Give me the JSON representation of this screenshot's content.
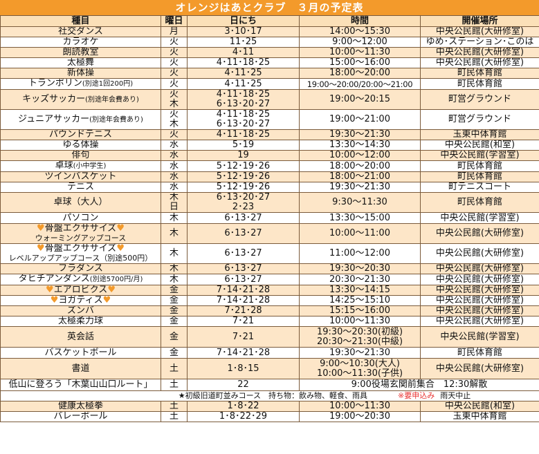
{
  "title": "オレンジはあとクラブ　３月の予定表",
  "columns": [
    "種目",
    "曜日",
    "日にち",
    "時間",
    "開催場所"
  ],
  "rows": [
    {
      "name": "社交ダンス",
      "day": "月",
      "dates": "3･10･17",
      "time": "14:00～15:30",
      "place": "中央公民館(大研修室)"
    },
    {
      "name": "カラオケ",
      "day": "火",
      "dates": "11･25",
      "time": "9:00～12:00",
      "place": "ゆめ･ステーション･このは"
    },
    {
      "name": "朗読教室",
      "day": "火",
      "dates": "4･11",
      "time": "10:00～11:30",
      "place": "中央公民館(大研修室)"
    },
    {
      "name": "太極舞",
      "day": "火",
      "dates": "4･11･18･25",
      "time": "15:00～16:00",
      "place": "中央公民館(大研修室)"
    },
    {
      "name": "新体操",
      "day": "火",
      "dates": "4･11･25",
      "time": "18:00～20:00",
      "place": "町民体育館"
    },
    {
      "name": "トランポリン",
      "name_note": "(別途1回200円)",
      "day": "火",
      "dates": "4･11･25",
      "time": "19:00～20:00/20:00～21:00",
      "place": "町民体育館"
    },
    {
      "name": "キッズサッカー",
      "name_note": "(別途年会費あり)",
      "day": "火",
      "day2": "木",
      "dates": "4･11･18･25",
      "dates2": "6･13･20･27",
      "time": "19:00～20:15",
      "place": "町営グラウンド"
    },
    {
      "name": "ジュニアサッカー",
      "name_note": "(別途年会費あり)",
      "day": "火",
      "day2": "木",
      "dates": "4･11･18･25",
      "dates2": "6･13･20･27",
      "time": "19:00～21:00",
      "place": "町営グラウンド"
    },
    {
      "name": "パウンドテニス",
      "day": "火",
      "dates": "4･11･18･25",
      "time": "19:30～21:30",
      "place": "玉東中体育館"
    },
    {
      "name": "ゆる体操",
      "day": "水",
      "dates": "5･19",
      "time": "13:30～14:30",
      "place": "中央公民館(和室)"
    },
    {
      "name": "俳句",
      "day": "水",
      "dates": "19",
      "time": "10:00～12:00",
      "place": "中央公民館(学習室)"
    },
    {
      "name": "卓球",
      "name_note": "(小中学生)",
      "day": "水",
      "dates": "5･12･19･26",
      "time": "18:00～20:00",
      "place": "町民体育館"
    },
    {
      "name": "ツインバスケット",
      "day": "水",
      "dates": "5･12･19･26",
      "time": "18:00～21:00",
      "place": "町民体育館"
    },
    {
      "name": "テニス",
      "day": "水",
      "dates": "5･12･19･26",
      "time": "19:30～21:30",
      "place": "町テニスコート"
    },
    {
      "name": "卓球（大人）",
      "day": "木",
      "day2": "日",
      "dates": "6･13･20･27",
      "dates2": "2･23",
      "time": "9:30～11:30",
      "place": "町民体育館"
    },
    {
      "name": "パソコン",
      "day": "木",
      "dates": "6･13･27",
      "time": "13:30～15:00",
      "place": "中央公民館(学習室)"
    },
    {
      "name": "骨盤エクササイズ",
      "name_sub": "ウォーミングアップコース",
      "heart": "♥",
      "day": "木",
      "dates": "6･13･27",
      "time": "10:00～11:00",
      "place": "中央公民館(大研修室)"
    },
    {
      "name": "骨盤エクササイズ",
      "name_sub": "レベルアップアップコース（別途500円）",
      "heart": "♥",
      "day": "木",
      "dates": "6･13･27",
      "time": "11:00～12:00",
      "place": "中央公民館(大研修室)"
    },
    {
      "name": "フラダンス",
      "day": "木",
      "dates": "6･13･27",
      "time": "19:30～20:30",
      "place": "中央公民館(大研修室)"
    },
    {
      "name": "タヒチアンダンス",
      "name_note": "(別途5700円/月)",
      "day": "木",
      "dates": "6･13･27",
      "time": "20:30～21:30",
      "place": "中央公民館(大研修室)"
    },
    {
      "name": "エアロビクス",
      "heart": "♥",
      "day": "金",
      "dates": "7･14･21･28",
      "time": "13:30～14:15",
      "place": "中央公民館(大研修室)"
    },
    {
      "name": "ヨガティス",
      "heart": "♥",
      "day": "金",
      "dates": "7･14･21･28",
      "time": "14:25～15:10",
      "place": "中央公民館(大研修室)"
    },
    {
      "name": "ズンバ",
      "day": "金",
      "dates": "7･21･28",
      "time": "15:15～16:00",
      "place": "中央公民館(大研修室)"
    },
    {
      "name": "太極柔力球",
      "day": "金",
      "dates": "7･21",
      "time": "10:00～11:30",
      "place": "中央公民館(大研修室)"
    },
    {
      "name": "英会話",
      "day": "金",
      "dates": "7･21",
      "time": "19:30～20:30(初級)",
      "time2": "20:30～21:30(中級)",
      "place": "中央公民館(学習室)"
    },
    {
      "name": "バスケットボール",
      "day": "金",
      "dates": "7･14･21･28",
      "time": "19:30～21:30",
      "place": "町民体育館"
    },
    {
      "name": "書道",
      "day": "土",
      "dates": "1･8･15",
      "time": "9:00～10:30(大人)",
      "time2": "10:00～11:30(子供)",
      "place": "中央公民館(大研修室)"
    },
    {
      "name": "低山に登ろう「木葉山山口ルート」",
      "day": "土",
      "dates": "22",
      "time": "9:00役場玄関前集合　12:30解散",
      "place": ""
    },
    {
      "name": "健康太極拳",
      "day": "土",
      "dates": "1･8･22",
      "time": "10:00～11:30",
      "place": "中央公民館(和室)"
    },
    {
      "name": "バレーボール",
      "day": "土",
      "dates": "1･8･22･29",
      "time": "19:00～20:30",
      "place": "玉東中体育館"
    }
  ],
  "hike_note": {
    "left": "★初級旧道町並みコース　持ち物：飲み物、軽食、雨具",
    "red": "※要申込み",
    "right": "雨天中止"
  }
}
